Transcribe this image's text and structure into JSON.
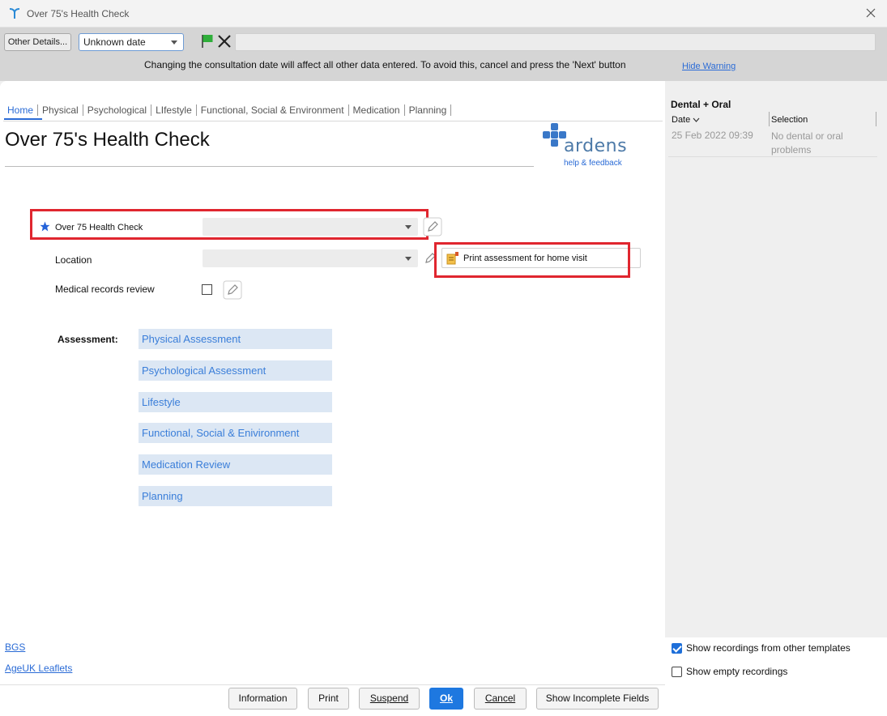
{
  "window": {
    "title": "Over 75's Health Check"
  },
  "toolbar": {
    "other_details": "Other Details...",
    "date_value": "Unknown date",
    "warning": "Changing the consultation date will affect all other data entered. To avoid this, cancel and press the 'Next' button",
    "hide_warning": "Hide Warning"
  },
  "tabs": [
    {
      "label": "Home"
    },
    {
      "label": "Physical"
    },
    {
      "label": "Psychological"
    },
    {
      "label": "LIfestyle"
    },
    {
      "label": "Functional, Social & Environment"
    },
    {
      "label": "Medication"
    },
    {
      "label": "Planning"
    }
  ],
  "page": {
    "title": "Over 75's Health Check"
  },
  "logo": {
    "word": "ardens",
    "sub": "help & feedback"
  },
  "form": {
    "health_check_label": "Over 75 Health Check",
    "location_label": "Location",
    "medical_review_label": "Medical records review",
    "print_button": "Print assessment for home visit"
  },
  "assessment": {
    "label": "Assessment:",
    "items": [
      "Physical Assessment",
      "Psychological Assessment",
      "Lifestyle",
      "Functional, Social & Enivironment",
      "Medication Review",
      "Planning"
    ]
  },
  "links": {
    "bgs": "BGS",
    "ageuk": "AgeUK Leaflets"
  },
  "side_panel": {
    "heading": "Dental + Oral",
    "col_date": "Date",
    "col_selection": "Selection",
    "row_date": "25 Feb 2022 09:39",
    "row_selection": "No dental or oral problems",
    "show_other": "Show recordings from other templates",
    "show_other_checked": true,
    "show_empty": "Show empty recordings",
    "show_empty_checked": false
  },
  "buttons": {
    "information": "Information",
    "print": "Print",
    "suspend": "Suspend",
    "ok": "Ok",
    "cancel": "Cancel",
    "show_incomplete": "Show Incomplete Fields"
  },
  "colors": {
    "accent": "#2a6bd6",
    "highlight": "#e0262f",
    "assessment_bg": "#dce7f4"
  }
}
